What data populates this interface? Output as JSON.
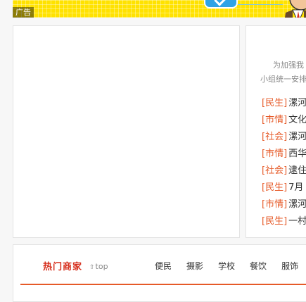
{
  "ad": {
    "label": "广告"
  },
  "notice": {
    "line1": "为加强我",
    "line2": "小组统一安排"
  },
  "news": [
    {
      "category": "[民生]",
      "title": "漯河"
    },
    {
      "category": "[市情]",
      "title": "文化"
    },
    {
      "category": "[社会]",
      "title": "漯河"
    },
    {
      "category": "[市情]",
      "title": "西华"
    },
    {
      "category": "[社会]",
      "title": "逮住"
    },
    {
      "category": "[民生]",
      "title": "7月"
    },
    {
      "category": "[市情]",
      "title": "漯河"
    },
    {
      "category": "[民生]",
      "title": "一村"
    }
  ],
  "merchants": {
    "title": "热门商家",
    "top_label": "top",
    "categories": [
      "便民",
      "摄影",
      "学校",
      "餐饮",
      "服饰"
    ]
  },
  "colors": {
    "accent": "#e65a28",
    "title_red": "#d62e1c",
    "ad_yellow": "#ffe200"
  }
}
